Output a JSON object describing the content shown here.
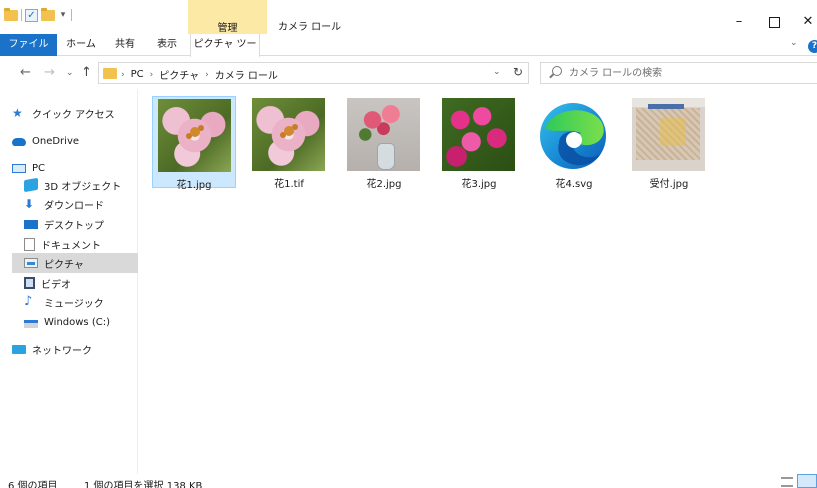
{
  "window": {
    "title": "カメラ ロール",
    "context_tab_group": "管理",
    "minimize_label": "–",
    "close_label": "✕"
  },
  "ribbon": {
    "tabs": {
      "file": "ファイル",
      "home": "ホーム",
      "share": "共有",
      "view": "表示",
      "picture_tools": "ピクチャ ツール"
    },
    "expand_label": "⌄",
    "help_label": "?"
  },
  "nav": {
    "back": "←",
    "forward": "→",
    "recent": "⌄",
    "up": "↑",
    "breadcrumbs": [
      "PC",
      "ピクチャ",
      "カメラ ロール"
    ],
    "crumb_separator": "›",
    "address_dropdown": "⌄",
    "refresh": "↻"
  },
  "search": {
    "placeholder": "カメラ ロールの検索"
  },
  "sidebar": {
    "items": [
      {
        "label": "クイック アクセス",
        "icon": "star-icon"
      },
      {
        "label": "OneDrive",
        "icon": "cloud-icon"
      },
      {
        "label": "PC",
        "icon": "computer-icon"
      },
      {
        "label": "3D オブジェクト",
        "icon": "cube-icon"
      },
      {
        "label": "ダウンロード",
        "icon": "download-icon"
      },
      {
        "label": "デスクトップ",
        "icon": "desktop-icon"
      },
      {
        "label": "ドキュメント",
        "icon": "document-icon"
      },
      {
        "label": "ピクチャ",
        "icon": "pictures-icon",
        "selected": true
      },
      {
        "label": "ビデオ",
        "icon": "video-icon"
      },
      {
        "label": "ミュージック",
        "icon": "music-icon"
      },
      {
        "label": "Windows (C:)",
        "icon": "drive-icon"
      },
      {
        "label": "ネットワーク",
        "icon": "network-icon"
      }
    ]
  },
  "files": [
    {
      "name": "花1.jpg",
      "icon": "lily-photo",
      "selected": true
    },
    {
      "name": "花1.tif",
      "icon": "lily-photo",
      "selected": false
    },
    {
      "name": "花2.jpg",
      "icon": "flower-vase-photo",
      "selected": false
    },
    {
      "name": "花3.jpg",
      "icon": "pink-flowers-photo",
      "selected": false
    },
    {
      "name": "花4.svg",
      "icon": "edge-logo",
      "selected": false
    },
    {
      "name": "受付.jpg",
      "icon": "reception-photo",
      "selected": false
    }
  ],
  "status": {
    "item_count": "6 個の項目",
    "selection": "1 個の項目を選択  138 KB"
  },
  "colors": {
    "accent": "#1a73c8",
    "selection_bg": "#cce8ff",
    "context_tab": "#fbe9a5"
  }
}
